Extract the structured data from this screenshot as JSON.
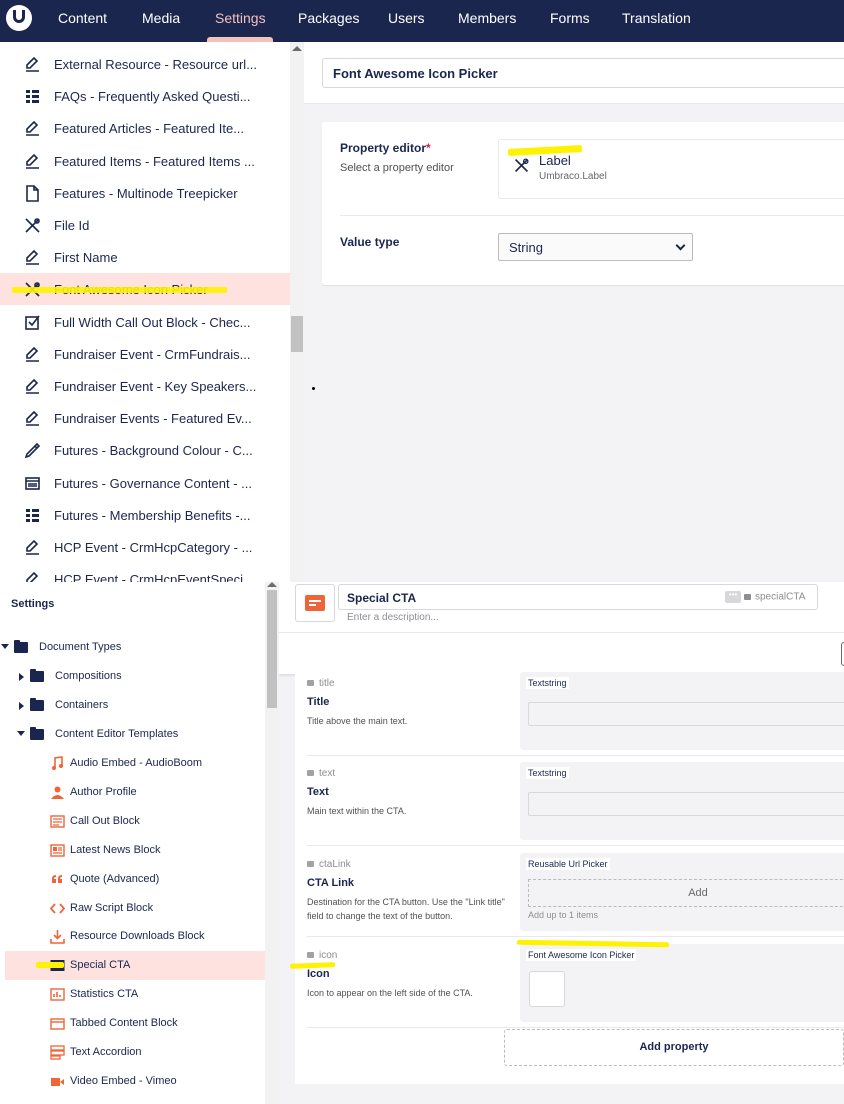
{
  "nav": {
    "items": [
      {
        "label": "Content"
      },
      {
        "label": "Media"
      },
      {
        "label": "Settings",
        "active": true
      },
      {
        "label": "Packages"
      },
      {
        "label": "Users"
      },
      {
        "label": "Members"
      },
      {
        "label": "Forms"
      },
      {
        "label": "Translation"
      }
    ]
  },
  "top_tree": {
    "items": [
      {
        "label": "External Resource - Resource url...",
        "icon": "edit-icon"
      },
      {
        "label": "FAQs - Frequently Asked Questi...",
        "icon": "list-icon"
      },
      {
        "label": "Featured Articles - Featured Ite...",
        "icon": "edit-icon"
      },
      {
        "label": "Featured Items - Featured Items ...",
        "icon": "edit-icon"
      },
      {
        "label": "Features - Multinode Treepicker",
        "icon": "document-icon"
      },
      {
        "label": "File Id",
        "icon": "tools-icon"
      },
      {
        "label": "First Name",
        "icon": "edit-icon"
      },
      {
        "label": "Font Awesome Icon Picker",
        "icon": "tools-icon",
        "selected": true
      },
      {
        "label": "Full Width Call Out Block - Chec...",
        "icon": "checkbox-icon"
      },
      {
        "label": "Fundraiser Event - CrmFundrais...",
        "icon": "edit-icon"
      },
      {
        "label": "Fundraiser Event - Key Speakers...",
        "icon": "edit-icon"
      },
      {
        "label": "Fundraiser Events - Featured Ev...",
        "icon": "edit-icon"
      },
      {
        "label": "Futures - Background Colour - C...",
        "icon": "eyedropper-icon"
      },
      {
        "label": "Futures - Governance Content - ...",
        "icon": "window-icon"
      },
      {
        "label": "Futures - Membership Benefits -...",
        "icon": "list-icon"
      },
      {
        "label": "HCP Event - CrmHcpCategory - ...",
        "icon": "edit-icon"
      },
      {
        "label": "HCP Event - CrmHcpEventSpeci...",
        "icon": "edit-icon"
      }
    ]
  },
  "datatype_editor": {
    "name_value": "Font Awesome Icon Picker",
    "property_editor_label": "Property editor",
    "required_mark": "*",
    "property_editor_desc": "Select a property editor",
    "selected_editor_name": "Label",
    "selected_editor_alias": "Umbraco.Label",
    "value_type_label": "Value type",
    "value_type_value": "String"
  },
  "settings_tree": {
    "title": "Settings",
    "root": "Document Types",
    "folders": [
      {
        "label": "Compositions",
        "expanded": false
      },
      {
        "label": "Containers",
        "expanded": false
      },
      {
        "label": "Content Editor Templates",
        "expanded": true
      }
    ],
    "templates": [
      {
        "label": "Audio Embed - AudioBoom",
        "icon": "music-icon"
      },
      {
        "label": "Author Profile",
        "icon": "user-icon"
      },
      {
        "label": "Call Out Block",
        "icon": "callout-icon"
      },
      {
        "label": "Latest News Block",
        "icon": "newspaper-icon"
      },
      {
        "label": "Quote (Advanced)",
        "icon": "quote-icon"
      },
      {
        "label": "Raw Script Block",
        "icon": "code-icon"
      },
      {
        "label": "Resource Downloads Block",
        "icon": "download-icon"
      },
      {
        "label": "Special CTA",
        "icon": "id-card-icon",
        "selected": true
      },
      {
        "label": "Statistics CTA",
        "icon": "stats-icon"
      },
      {
        "label": "Tabbed Content Block",
        "icon": "tabs-icon"
      },
      {
        "label": "Text Accordion",
        "icon": "accordion-icon"
      },
      {
        "label": "Video Embed - Vimeo",
        "icon": "video-icon"
      }
    ],
    "accent_color": "#f0643a"
  },
  "doctype_editor": {
    "name_value": "Special CTA",
    "description_placeholder": "Enter a description...",
    "alias": "specialCTA",
    "properties": [
      {
        "alias": "title",
        "name": "Title",
        "description": "Title above the main text.",
        "editor": "Textstring"
      },
      {
        "alias": "text",
        "name": "Text",
        "description": "Main text within the CTA.",
        "editor": "Textstring"
      },
      {
        "alias": "ctaLink",
        "name": "CTA Link",
        "description": "Destination for the CTA button. Use the \"Link title\" field to change the text of the button.",
        "editor": "Reusable Url Picker",
        "add_label": "Add",
        "hint": "Add up to 1 items"
      },
      {
        "alias": "icon",
        "name": "Icon",
        "description": "Icon to appear on the left side of the CTA.",
        "editor": "Font Awesome Icon Picker"
      }
    ],
    "add_property_label": "Add property"
  },
  "colors": {
    "nav_bg": "#1b264f",
    "selected_row": "#fde2df",
    "highlight": "#fff200"
  }
}
